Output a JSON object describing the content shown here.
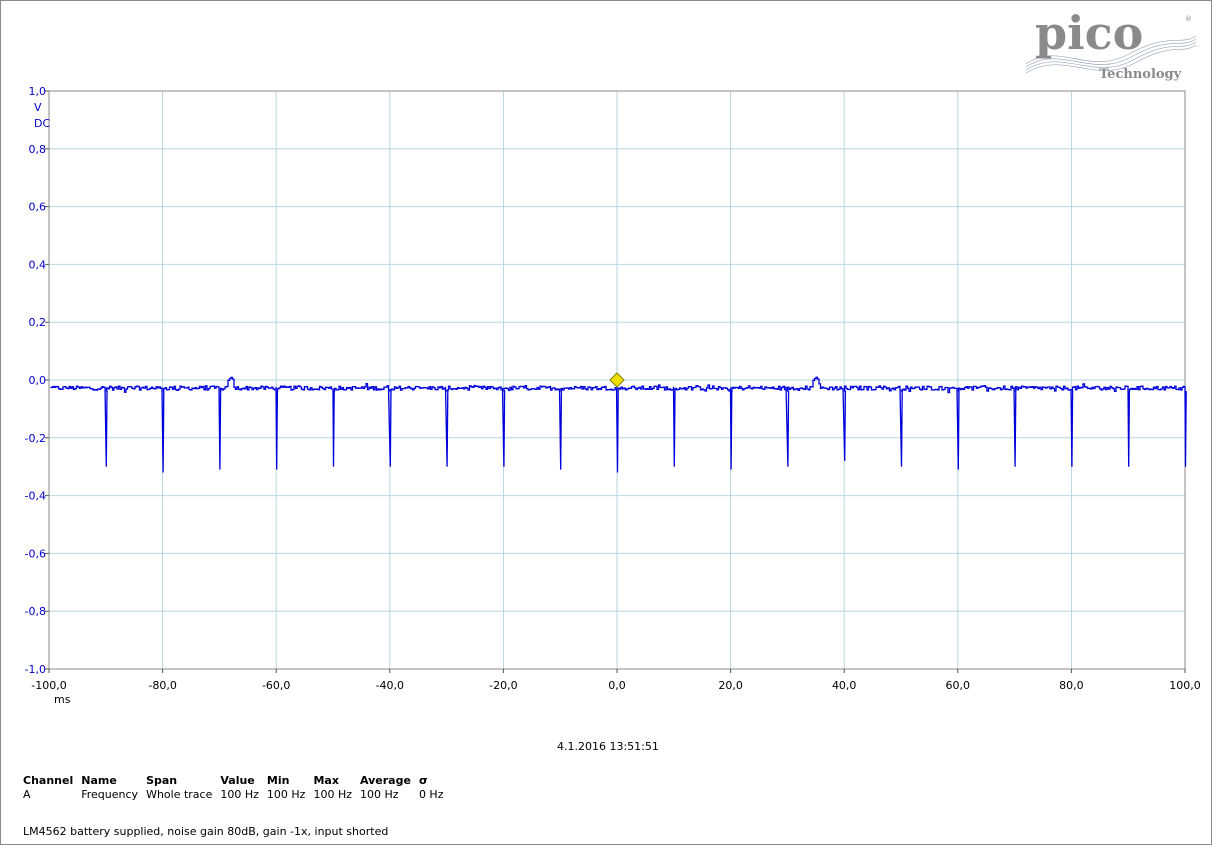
{
  "brand": {
    "name": "pico",
    "sub": "Technology"
  },
  "timestamp": "4.1.2016 13:51:51",
  "measurements": {
    "headers": [
      "Channel",
      "Name",
      "Span",
      "Value",
      "Min",
      "Max",
      "Average",
      "σ"
    ],
    "rows": [
      [
        "A",
        "Frequency",
        "Whole trace",
        "100 Hz",
        "100 Hz",
        "100 Hz",
        "100 Hz",
        "0 Hz"
      ]
    ]
  },
  "note": "LM4562 battery supplied, noise gain 80dB, gain -1x, input shorted",
  "colors": {
    "trace": "#0000dd",
    "grid": "#b8d4e0",
    "axis_text": "#0000cc",
    "trigger": "#f0e000"
  },
  "chart_data": {
    "type": "line",
    "title": "",
    "xlabel": "ms",
    "ylabel": "V",
    "ylabel_sub": "DC",
    "xlim": [
      -100,
      100
    ],
    "ylim": [
      -1,
      1
    ],
    "xticks": [
      -100,
      -80,
      -60,
      -40,
      -20,
      0,
      20,
      40,
      60,
      80,
      100
    ],
    "xtick_labels": [
      "-100,0",
      "-80,0",
      "-60,0",
      "-40,0",
      "-20,0",
      "0,0",
      "20,0",
      "40,0",
      "60,0",
      "80,0",
      "100,0"
    ],
    "yticks": [
      1,
      0.8,
      0.6,
      0.4,
      0.2,
      0,
      -0.2,
      -0.4,
      -0.6,
      -0.8,
      -1
    ],
    "ytick_labels": [
      "1,0",
      "0,8",
      "0,6",
      "0,4",
      "0,2",
      "0,0",
      "-0,2",
      "-0,4",
      "-0,6",
      "-0,8",
      "-1,0"
    ],
    "grid": true,
    "baseline": -0.028,
    "series": [
      {
        "spikes_x": [
          -90,
          -80,
          -70,
          -60,
          -50,
          -40,
          -30,
          -20,
          -10,
          0,
          10,
          20,
          30,
          40,
          50,
          60,
          70,
          80,
          90,
          100
        ],
        "spikes_y": [
          -0.3,
          -0.32,
          -0.31,
          -0.31,
          -0.3,
          -0.3,
          -0.3,
          -0.3,
          -0.31,
          -0.32,
          -0.3,
          -0.31,
          -0.3,
          -0.28,
          -0.3,
          -0.31,
          -0.3,
          -0.3,
          -0.3,
          -0.3
        ],
        "bumps_x": [
          -68,
          35
        ],
        "bumps_y": [
          0.01,
          0.01
        ]
      }
    ],
    "trigger": {
      "x": 0,
      "y": 0
    }
  }
}
